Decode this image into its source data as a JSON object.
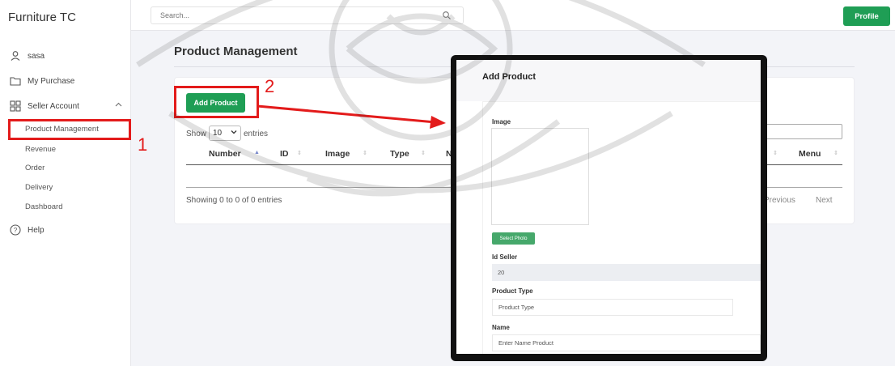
{
  "app": {
    "brand": "Furniture TC"
  },
  "header": {
    "search_placeholder": "Search...",
    "profile_label": "Profile"
  },
  "sidebar": {
    "user": "sasa",
    "my_purchase": "My Purchase",
    "seller_account": "Seller Account",
    "sub_items": [
      "Product Management",
      "Revenue",
      "Order",
      "Delivery",
      "Dashboard"
    ],
    "help": "Help"
  },
  "main": {
    "title": "Product Management",
    "add_button": "Add Product",
    "show_label": "Show",
    "entries_value": "10",
    "entries_label": "entries",
    "columns": [
      "Number",
      "ID",
      "Image",
      "Type",
      "N"
    ],
    "right_column": "Menu",
    "info": "Showing 0 to 0 of 0 entries",
    "pager": {
      "previous": "Previous",
      "next": "Next"
    }
  },
  "annotations": {
    "one": "1",
    "two": "2"
  },
  "modal": {
    "title": "Add Product",
    "image_label": "Image",
    "select_photo": "Select Photo",
    "id_seller_label": "Id Seller",
    "id_seller_value": "20",
    "product_type_label": "Product Type",
    "product_type_placeholder": "Product Type",
    "name_label": "Name",
    "name_placeholder": "Enter Name Product"
  },
  "colors": {
    "primary_green": "#1f9e55",
    "annotation_red": "#e31b1b"
  }
}
